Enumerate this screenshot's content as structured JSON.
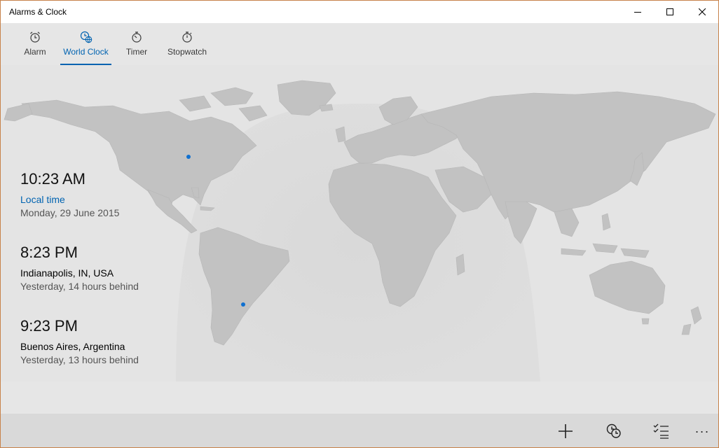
{
  "window": {
    "title": "Alarms & Clock"
  },
  "tabs": [
    {
      "label": "Alarm",
      "icon": "alarm-icon"
    },
    {
      "label": "World Clock",
      "icon": "world-clock-icon",
      "active": true
    },
    {
      "label": "Timer",
      "icon": "timer-icon"
    },
    {
      "label": "Stopwatch",
      "icon": "stopwatch-icon"
    }
  ],
  "clocks": [
    {
      "time": "10:23 AM",
      "place": "Local time",
      "detail": "Monday, 29 June 2015"
    },
    {
      "time": "8:23 PM",
      "place": "Indianapolis, IN, USA",
      "detail": "Yesterday, 14 hours behind"
    },
    {
      "time": "9:23 PM",
      "place": "Buenos Aires, Argentina",
      "detail": "Yesterday, 13 hours behind"
    }
  ],
  "appbar": {
    "buttons": [
      "add-icon",
      "compare-icon",
      "select-icon",
      "more-icon"
    ],
    "more_label": "···"
  },
  "colors": {
    "accent": "#0063b1",
    "land": "#c2c2c2",
    "night": "#d5d5d5",
    "day": "#e6e6e6"
  }
}
